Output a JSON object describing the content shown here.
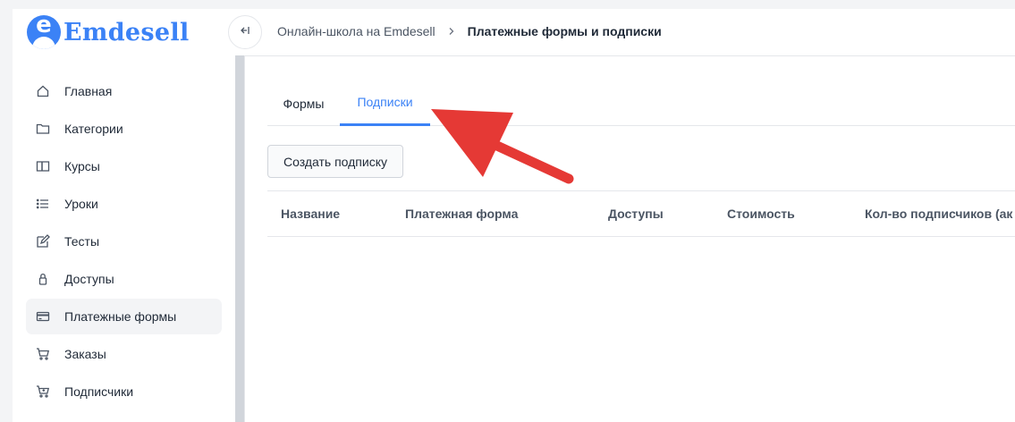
{
  "brand": {
    "name": "Emdesell",
    "logo_letter": "e",
    "color": "#3b82f6"
  },
  "sidebar": {
    "items": [
      {
        "label": "Главная",
        "icon": "home-icon",
        "active": false
      },
      {
        "label": "Категории",
        "icon": "folder-icon",
        "active": false
      },
      {
        "label": "Курсы",
        "icon": "book-icon",
        "active": false
      },
      {
        "label": "Уроки",
        "icon": "list-icon",
        "active": false
      },
      {
        "label": "Тесты",
        "icon": "edit-icon",
        "active": false
      },
      {
        "label": "Доступы",
        "icon": "lock-icon",
        "active": false
      },
      {
        "label": "Платежные формы",
        "icon": "credit-card-icon",
        "active": true
      },
      {
        "label": "Заказы",
        "icon": "cart-icon",
        "active": false
      },
      {
        "label": "Подписчики",
        "icon": "cart-plus-icon",
        "active": false
      }
    ]
  },
  "header": {
    "collapse_icon": "collapse-sidebar-icon",
    "breadcrumb": {
      "parent": "Онлайн-школа на Emdesell",
      "separator_icon": "chevron-right-icon",
      "current": "Платежные формы и подписки"
    }
  },
  "tabs": [
    {
      "label": "Формы",
      "active": false
    },
    {
      "label": "Подписки",
      "active": true
    }
  ],
  "actions": {
    "create_label": "Создать подписку"
  },
  "table": {
    "columns": [
      "Название",
      "Платежная форма",
      "Доступы",
      "Стоимость",
      "Кол-во подписчиков (ак"
    ]
  },
  "annotation": {
    "arrow_color": "#e53935",
    "icon": "red-arrow-annotation"
  }
}
